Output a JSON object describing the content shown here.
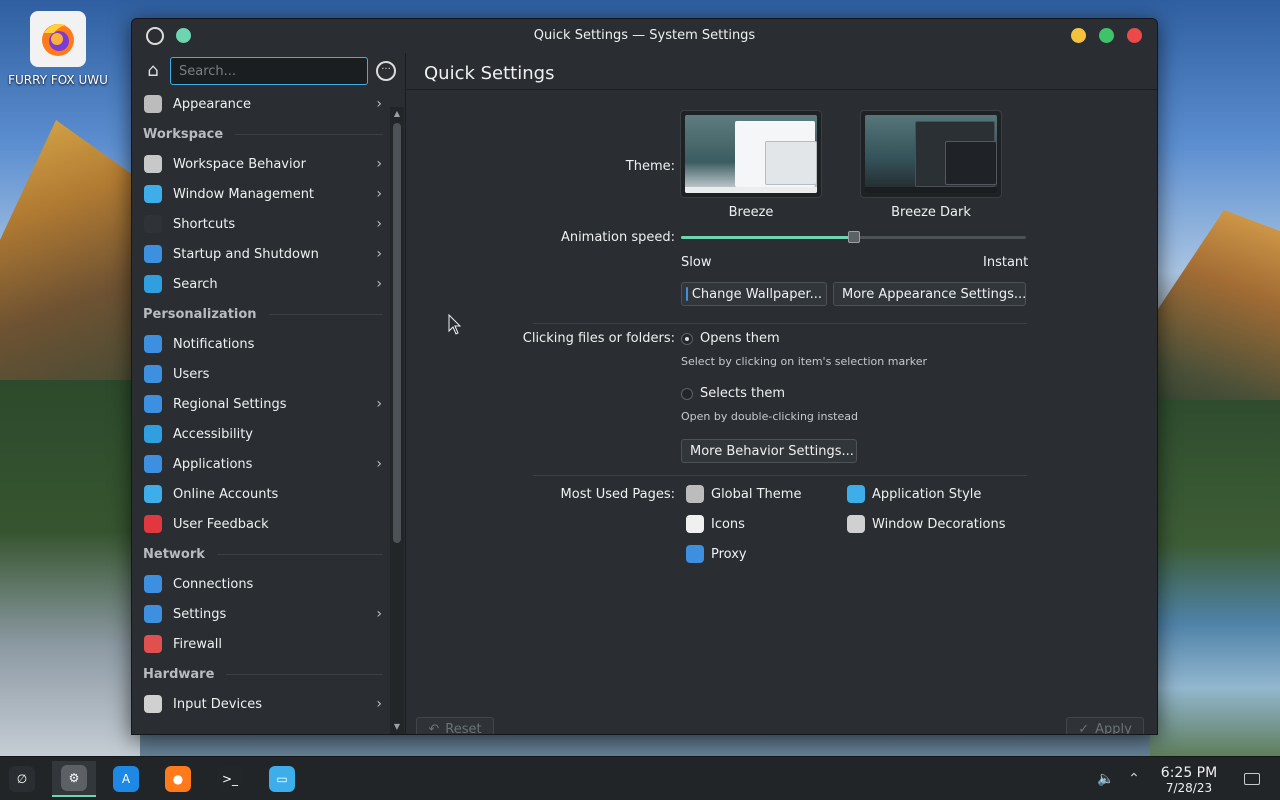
{
  "desktop": {
    "icons": [
      {
        "caption": "FURRY FOX UWU",
        "icon": "firefox-icon"
      }
    ]
  },
  "window": {
    "title": "Quick Settings — System Settings",
    "buttons": [
      "menu-icon",
      "pin-icon",
      "minimize-icon",
      "maximize-icon",
      "close-icon"
    ]
  },
  "sidebar": {
    "search_placeholder": "Search...",
    "items": [
      {
        "type": "item",
        "label": "Appearance",
        "icon": "appearance-icon",
        "color": "#bcbcbc",
        "chevron": true
      },
      {
        "type": "section",
        "label": "Workspace"
      },
      {
        "type": "item",
        "label": "Workspace Behavior",
        "icon": "workspace-icon",
        "color": "#c8c8c8",
        "chevron": true
      },
      {
        "type": "item",
        "label": "Window Management",
        "icon": "window-icon",
        "color": "#3daee9",
        "chevron": true
      },
      {
        "type": "item",
        "label": "Shortcuts",
        "icon": "shortcuts-icon",
        "color": "#2f3337",
        "chevron": true
      },
      {
        "type": "item",
        "label": "Startup and Shutdown",
        "icon": "startup-icon",
        "color": "#3d8fe0",
        "chevron": true
      },
      {
        "type": "item",
        "label": "Search",
        "icon": "search-icon",
        "color": "#2f9fe0",
        "chevron": true
      },
      {
        "type": "section",
        "label": "Personalization"
      },
      {
        "type": "item",
        "label": "Notifications",
        "icon": "notifications-icon",
        "color": "#3d8fe0",
        "chevron": false
      },
      {
        "type": "item",
        "label": "Users",
        "icon": "users-icon",
        "color": "#3d8fe0",
        "chevron": false
      },
      {
        "type": "item",
        "label": "Regional Settings",
        "icon": "regional-icon",
        "color": "#3d8fe0",
        "chevron": true
      },
      {
        "type": "item",
        "label": "Accessibility",
        "icon": "accessibility-icon",
        "color": "#2f9fe0",
        "chevron": false
      },
      {
        "type": "item",
        "label": "Applications",
        "icon": "applications-icon",
        "color": "#3d8fe0",
        "chevron": true
      },
      {
        "type": "item",
        "label": "Online Accounts",
        "icon": "online-accounts-icon",
        "color": "#3daee9",
        "chevron": false
      },
      {
        "type": "item",
        "label": "User Feedback",
        "icon": "feedback-icon",
        "color": "#e0383e",
        "chevron": false
      },
      {
        "type": "section",
        "label": "Network"
      },
      {
        "type": "item",
        "label": "Connections",
        "icon": "connections-icon",
        "color": "#3d8fe0",
        "chevron": false
      },
      {
        "type": "item",
        "label": "Settings",
        "icon": "network-settings-icon",
        "color": "#3d8fe0",
        "chevron": true
      },
      {
        "type": "item",
        "label": "Firewall",
        "icon": "firewall-icon",
        "color": "#e0504e",
        "chevron": false
      },
      {
        "type": "section",
        "label": "Hardware"
      },
      {
        "type": "item",
        "label": "Input Devices",
        "icon": "input-devices-icon",
        "color": "#d0d0d0",
        "chevron": true
      }
    ]
  },
  "main": {
    "page_title": "Quick Settings",
    "theme_label": "Theme:",
    "themes": [
      {
        "name": "Breeze",
        "variant": "light",
        "selected": true
      },
      {
        "name": "Breeze Dark",
        "variant": "dark",
        "selected": false
      }
    ],
    "animation_label": "Animation speed:",
    "animation_speed": 0.5,
    "slow_label": "Slow",
    "instant_label": "Instant",
    "change_wallpaper": "Change Wallpaper...",
    "more_appearance": "More Appearance Settings...",
    "clicking_label": "Clicking files or folders:",
    "option_open": "Opens them",
    "option_open_hint": "Select by clicking on item's selection marker",
    "option_select": "Selects them",
    "option_select_hint": "Open by double-clicking instead",
    "selected_option": "open",
    "more_behavior": "More Behavior Settings...",
    "most_used_label": "Most Used Pages:",
    "most_used": [
      {
        "label": "Global Theme",
        "icon": "global-theme-icon",
        "color": "#bcbcbc"
      },
      {
        "label": "Application Style",
        "icon": "application-style-icon",
        "color": "#3daee9"
      },
      {
        "label": "Icons",
        "icon": "icons-icon",
        "color": "#f0f0f0"
      },
      {
        "label": "Window Decorations",
        "icon": "window-decorations-icon",
        "color": "#d0d0d0"
      },
      {
        "label": "Proxy",
        "icon": "proxy-icon",
        "color": "#3d8fe0"
      }
    ],
    "reset_label": "Reset",
    "apply_label": "Apply"
  },
  "taskbar": {
    "apps": [
      {
        "name": "launcher-icon",
        "active": false
      },
      {
        "name": "system-settings-icon",
        "active": true
      },
      {
        "name": "app-store-icon",
        "active": false
      },
      {
        "name": "firefox-icon",
        "active": false
      },
      {
        "name": "terminal-icon",
        "active": false
      },
      {
        "name": "file-manager-icon",
        "active": false
      }
    ],
    "time": "6:25 PM",
    "date": "7/28/23"
  },
  "colors": {
    "accent": "#6fd4b2",
    "focus": "#3daee9",
    "window_bg": "#2a2e32"
  }
}
